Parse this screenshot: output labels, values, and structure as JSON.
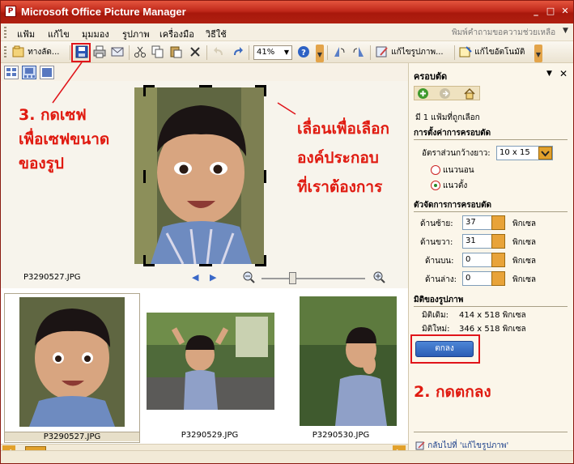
{
  "window": {
    "title": "Microsoft Office Picture Manager",
    "app_icon_label": "P",
    "controls": {
      "minimize": "_",
      "maximize": "□",
      "close": "✕"
    }
  },
  "menu": {
    "items": [
      "แฟ้ม",
      "แก้ไข",
      "มุมมอง",
      "รูปภาพ",
      "เครื่องมือ",
      "วิธีใช้"
    ],
    "help_placeholder": "พิมพ์คำถามขอความช่วยเหลือ"
  },
  "toolbar": {
    "shortcuts_label": "ทางลัด...",
    "zoom_value": "41%",
    "edit_pictures_label": "แก้ไขรูปภาพ...",
    "auto_correct_label": "แก้ไขอัตโนมัติ"
  },
  "viewer": {
    "filename": "P3290527.JPG"
  },
  "thumbnails": [
    {
      "filename": "P3290527.JPG",
      "selected": true
    },
    {
      "filename": "P3290529.JPG",
      "selected": false
    },
    {
      "filename": "P3290530.JPG",
      "selected": false
    }
  ],
  "task_pane": {
    "title": "ครอบตัด",
    "selection_count": "มี 1 แฟ้มที่ถูกเลือก",
    "crop_settings_heading": "การตั้งค่าการครอบตัด",
    "aspect_ratio_label": "อัตราส่วนกว้างยาว:",
    "aspect_ratio_value": "10 x 15",
    "orientation_landscape": "แนวนอน",
    "orientation_portrait": "แนวตั้ง",
    "orientation_selected": "portrait",
    "handles_heading": "ตัวจัดการการครอบตัด",
    "left_label": "ด้านซ้าย:",
    "left_value": "37",
    "right_label": "ด้านขวา:",
    "right_value": "31",
    "top_label": "ด้านบน:",
    "top_value": "0",
    "bottom_label": "ด้านล่าง:",
    "bottom_value": "0",
    "unit": "พิกเซล",
    "dimensions_heading": "มิติของรูปภาพ",
    "original_label": "มิติเดิม:",
    "original_value": "414 x 518 พิกเซล",
    "new_label": "มิติใหม่:",
    "new_value": "346 x 518 พิกเซล",
    "ok_button": "ตกลง",
    "back_link": "กลับไปที่ 'แก้ไขรูปภาพ'"
  },
  "annotations": {
    "save_step_line1": "3. กดเซฟ",
    "save_step_line2": "เพื่อเซฟขนาด",
    "save_step_line3": "ของรูป",
    "drag_hint_line1": "เลื่อนเพื่อเลือก",
    "drag_hint_line2": "องค์ประกอบ",
    "drag_hint_line3": "ที่เราต้องการ",
    "ok_step": "2. กดตกลง"
  },
  "colors": {
    "title_bar": "#c0281a",
    "annotation_red": "#e01a10",
    "ok_button": "#2b5db5",
    "toolbar_accent": "#e3a44a"
  }
}
